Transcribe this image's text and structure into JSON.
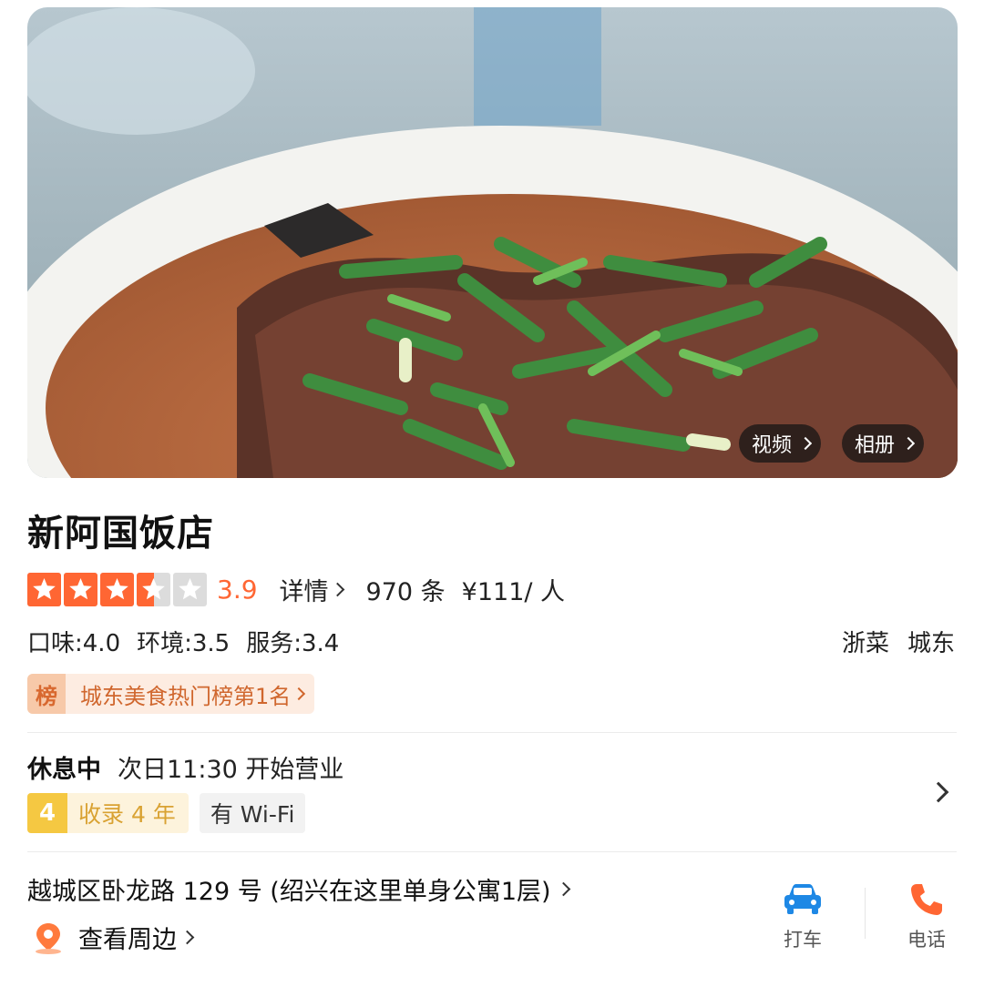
{
  "hero": {
    "video_label": "视频",
    "album_label": "相册"
  },
  "shop": {
    "name": "新阿国饭店",
    "rating_stars": 3.5,
    "score": "3.9",
    "details_label": "详情",
    "review_count": "970 条",
    "avg_price": "¥111/ 人",
    "subscores": [
      "口味:4.0",
      "环境:3.5",
      "服务:3.4"
    ],
    "tags": [
      "浙菜",
      "城东"
    ],
    "rank_badge": "榜",
    "rank_text": "城东美食热门榜第1名"
  },
  "hours": {
    "status": "休息中",
    "next_open": "次日11:30 开始营业"
  },
  "badges": {
    "years_num": "4",
    "years_text": "收录 4 年",
    "wifi": "有 Wi-Fi"
  },
  "location": {
    "address": "越城区卧龙路 129 号 (绍兴在这里单身公寓1层)",
    "nearby": "查看周边"
  },
  "actions": {
    "taxi": "打车",
    "call": "电话"
  },
  "colors": {
    "accent": "#ff6633",
    "rank_text": "#d0672e",
    "years_badge": "#f5c842",
    "action_blue": "#1e88e5",
    "phone_orange": "#ff6633"
  },
  "icons": {
    "taxi": "car-icon",
    "call": "phone-icon",
    "nearby": "location-pin-icon",
    "rating": "star-icon"
  }
}
